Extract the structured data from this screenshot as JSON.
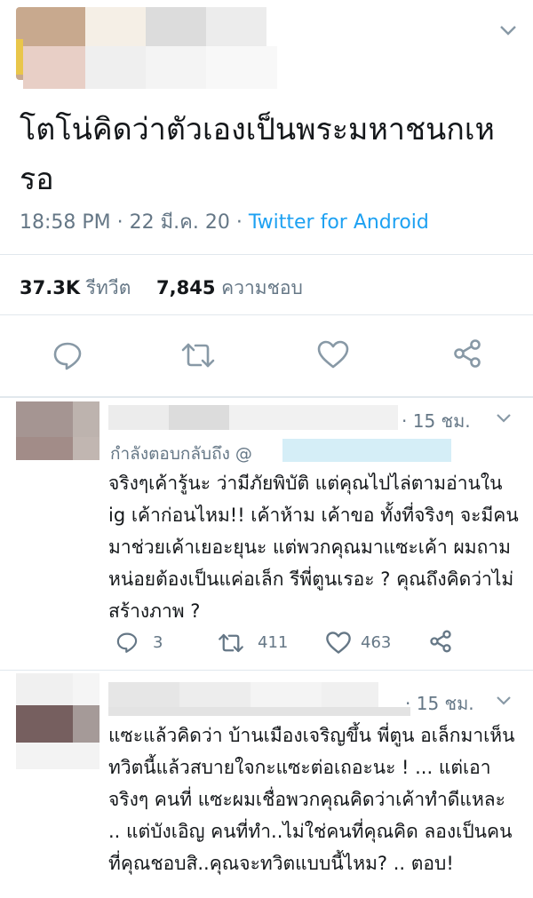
{
  "tweet": {
    "text": "โตโน่คิดว่าตัวเองเป็นพระมหาชนกเหรอ",
    "time": "18:58 PM",
    "sep": "·",
    "date": "22 มี.ค. 20",
    "source": "Twitter for Android",
    "retweets_count": "37.3K",
    "retweets_label": "รีทวีต",
    "likes_count": "7,845",
    "likes_label": "ความชอบ"
  },
  "replies": [
    {
      "time": "· 15 ชม.",
      "replying_to_label": "กำลังตอบกลับถึง @",
      "text": "จริงๆเค้ารู้นะ ว่ามีภัยพิบัติ แต่คุณไปไล่ตามอ่านใน ig เค้าก่อนไหม!! เค้าห้าม เค้าขอ ทั้งที่จริงๆ จะมีคนมาช่วยเค้าเยอะยุนะ แต่พวกคุณมาแซะเค้า ผมถามหน่อยต้องเป็นแค่อเล็ก รีพี่ตูนเรอะ ? คุณถึงคิดว่าไม่สร้างภาพ ?",
      "reply_count": "3",
      "retweet_count": "411",
      "like_count": "463"
    },
    {
      "time": "· 15 ชม.",
      "text": "แซะแล้วคิดว่า บ้านเมืองเจริญขึ้น พี่ตูน อเล็กมาเห็นทวิตนี้แล้วสบายใจกะแซะต่อเถอะนะ ! ... แต่เอาจริงๆ คนที่ แซะผมเชื่อพวกคุณคิดว่าเค้าทำดีแหละ .. แต่บังเอิญ คนที่ทำ..ไม่ใช่คนที่คุณคิด ลองเป็นคนที่คุณชอบสิ..คุณจะทวิตแบบนี้ไหม? .. ตอบ!"
    }
  ],
  "icons": [
    "chevron-down-icon",
    "reply-icon",
    "retweet-icon",
    "like-icon",
    "share-icon"
  ],
  "colors": {
    "link": "#1da1f2",
    "muted": "#657786",
    "divider": "#e1e8ed"
  }
}
